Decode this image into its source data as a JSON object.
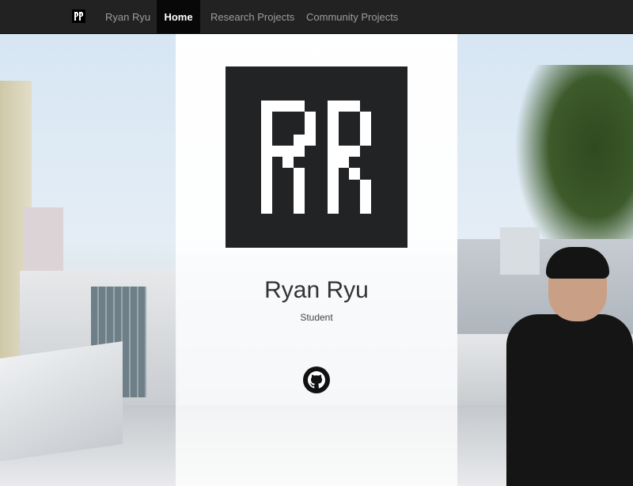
{
  "nav": {
    "brand_logo_text": "RR",
    "brand_label": "Ryan Ryu",
    "items": [
      {
        "label": "Home",
        "active": true
      },
      {
        "label": "Research Projects",
        "active": false
      },
      {
        "label": "Community Projects",
        "active": false
      }
    ]
  },
  "hero": {
    "logo_text": "RR",
    "name": "Ryan Ryu",
    "role": "Student",
    "social_icon": "github-icon"
  },
  "colors": {
    "navbar": "#222222",
    "nav_active": "#080808",
    "logo_bg": "#222324",
    "logo_fg": "#ffffff"
  }
}
